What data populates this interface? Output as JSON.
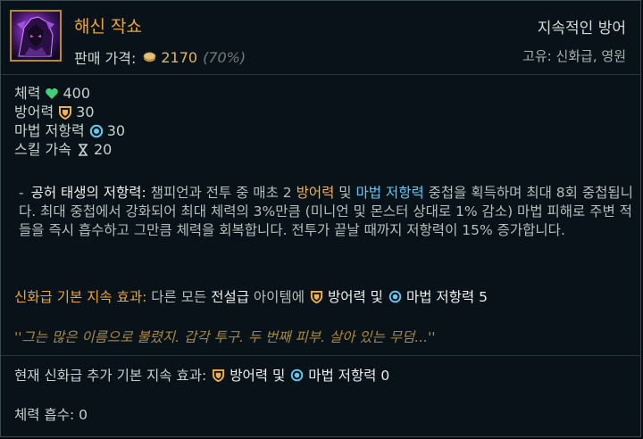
{
  "item": {
    "name": "해신 작쇼",
    "price_label": "판매 가격:",
    "price": "2170",
    "price_pct": "(70%)",
    "type": "지속적인 방어",
    "rarity": "고유: 신화급, 영원",
    "icon": "jaksho-item-icon"
  },
  "stats": [
    {
      "label": "체력",
      "icon": "heart-icon",
      "value": "400"
    },
    {
      "label": "방어력",
      "icon": "armor-shield-icon",
      "value": "30"
    },
    {
      "label": "마법 저항력",
      "icon": "magic-resist-icon",
      "value": "30"
    },
    {
      "label": "스킬 가속",
      "icon": "hourglass-icon",
      "value": "20"
    }
  ],
  "passive": {
    "dash": "-",
    "title": "공허 태생의 저항력:",
    "text1": "챔피언과 전투 중 매초 2",
    "armor": "방어력",
    "and": "및",
    "mr": "마법 저항력",
    "text2": "중첩을 획득하며 최대 8회 중첩됩니다. 최대 중첩에서 강화되어 최대 체력의 3%만큼 (미니언 및 몬스터 상대로 1% 감소) 마법 피해로 주변 적들을 즉시 흡수하고 그만큼 체력을 회복합니다. 전투가 끝날 때까지 저항력이 15% 증가합니다."
  },
  "mythic": {
    "title": "신화급 기본 지속 효과:",
    "text1": "다른 모든",
    "legendary": "전설급",
    "text2": "아이템에",
    "armor": "방어력 및",
    "mr": "마법 저항력 5"
  },
  "lore": "''그는 많은 이름으로 불렸지. 갑각 투구. 두 번째 피부. 살아 있는 무덤...''",
  "current": {
    "label": "현재 신화급 추가 기본 지속 효과:",
    "armor": "방어력 및",
    "mr": "마법 저항력 0"
  },
  "lifesteal": "체력 흡수: 0",
  "colors": {
    "gold": "#f0a52e",
    "armor": "#f1b14a",
    "magic_resist": "#66c8f0",
    "health": "#3fd07a"
  }
}
